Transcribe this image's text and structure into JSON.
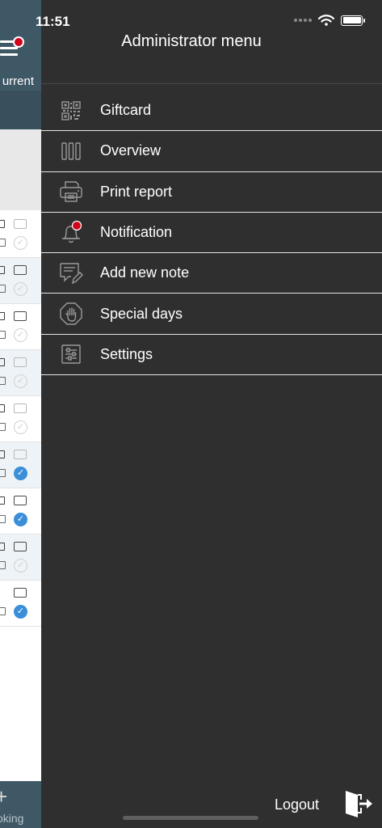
{
  "status_bar": {
    "time": "11:51"
  },
  "background_app": {
    "header_label": "urrent",
    "bottom_label": "oking"
  },
  "drawer": {
    "title": "Administrator menu",
    "items": [
      {
        "label": "Giftcard",
        "icon": "qr-code-icon"
      },
      {
        "label": "Overview",
        "icon": "columns-icon"
      },
      {
        "label": "Print report",
        "icon": "printer-icon"
      },
      {
        "label": "Notification",
        "icon": "bell-icon"
      },
      {
        "label": "Add new note",
        "icon": "note-edit-icon"
      },
      {
        "label": "Special days",
        "icon": "hand-stop-icon"
      },
      {
        "label": "Settings",
        "icon": "sliders-icon"
      }
    ],
    "logout_label": "Logout"
  },
  "colors": {
    "drawer_bg": "#2f2f2f",
    "header_bg": "#3f5866",
    "notification_dot": "#d0021b",
    "check_blue": "#3b8fd9"
  }
}
